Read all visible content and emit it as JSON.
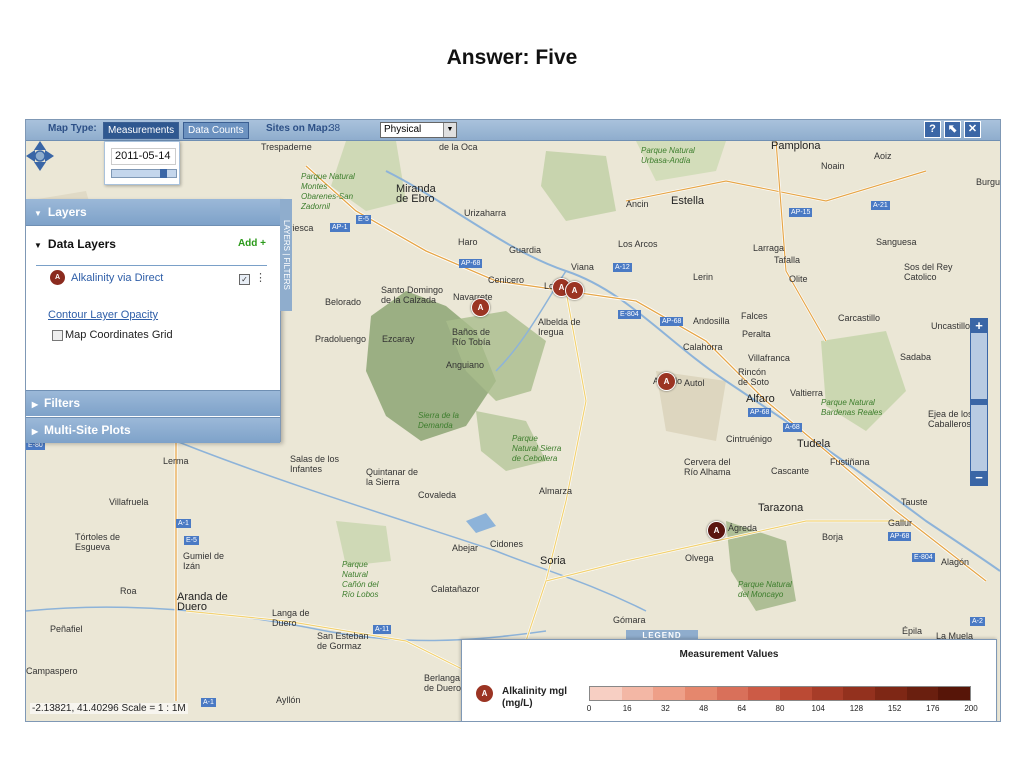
{
  "slide": {
    "title": "Answer: Five"
  },
  "toolbar": {
    "map_type_label": "Map Type:",
    "measurements_btn": "Measurements",
    "data_counts_btn": "Data Counts",
    "sites_on_map_label": "Sites on Map:",
    "sites_on_map_count": "38",
    "basemap_value": "Physical",
    "help_icon": "?",
    "print_icon": "⬉",
    "close_icon": "✕"
  },
  "date_popup": {
    "value": "2011-05-14",
    "slider_fraction": 0.85
  },
  "layers_panel": {
    "header": "Layers",
    "data_layers_title": "Data Layers",
    "add_link": "Add +",
    "layer_name": "Alkalinity via Direct",
    "layer_icon_text": "A",
    "layer_checked": true,
    "contour_link": "Contour Layer Opacity",
    "grid_label": "Map Coordinates Grid",
    "filters_header": "Filters",
    "multisite_header": "Multi-Site Plots",
    "side_tab": "LAYERS | FILTERS"
  },
  "places": [
    "Trespaderne",
    "de la Oca",
    "Pamplona",
    "Aoiz",
    "Noain",
    "Burgu",
    "Miranda de Ebro",
    "Parque Natural Montes Obarenes-San Zadornil",
    "Urizaharra",
    "Ancin",
    "Estella",
    "Haro",
    "Guardia",
    "Los Arcos",
    "Larraga",
    "Sanguesa",
    "Tafalla",
    "Viana",
    "Cenicero",
    "Lerin",
    "Olite",
    "Sos del Rey Catolico",
    "Santo Domingo de la Calzada",
    "Belorado",
    "Navarrete",
    "Logroño",
    "Albelda de Iregua",
    "Andosilla",
    "Falces",
    "Carcastillo",
    "Uncastillo",
    "Ezcaray",
    "Pradoluengo",
    "Baños de Río Tobía",
    "Calahorra",
    "Peralta",
    "Villafranca",
    "Sadaba",
    "Anguiano",
    "Arnedo",
    "Autol",
    "Rincón de Soto",
    "Valtierra",
    "Alfaro",
    "Parque Natural Bardenas Reales",
    "Ejea de los Caballeros",
    "Lerma",
    "Sierra de la Demanda",
    "Parque Natural Sierra de Cebollera",
    "Cintruénigo",
    "Tudela",
    "Salas de los Infantes",
    "Quintanar de la Sierra",
    "Cervera del Río Alhama",
    "Cascante",
    "Fustiñana",
    "Villafruela",
    "Covaleda",
    "Almarza",
    "Tarazona",
    "Tauste",
    "Tórtoles de Esgueva",
    "Gumiel de Izán",
    "Abejar",
    "Cidones",
    "Soria",
    "Ágreda",
    "Borja",
    "Gallur",
    "Parque Natural Cañón del Río Lobos",
    "Calatañazor",
    "Olvega",
    "Parque Natural del Moncayo",
    "Alagón",
    "Roa",
    "Aranda de Duero",
    "Langa de Duero",
    "Peñafiel",
    "San Esteban de Gormaz",
    "Gómara",
    "Épila",
    "La Muela",
    "Campaspero",
    "Berlanga de Duero",
    "Ayllón",
    "Viviesca",
    "Parque Natural Urbasa-Andía"
  ],
  "roads": [
    "AP-1",
    "E-5",
    "AP-68",
    "A-12",
    "AP-15",
    "A-21",
    "E-804",
    "AP-68",
    "A-68",
    "AP-68",
    "A-1",
    "E-5",
    "A-11",
    "AP-68",
    "E-804",
    "A-2",
    "A-1",
    "E-80"
  ],
  "markers": [
    {
      "label": "A",
      "near": "Navarrete"
    },
    {
      "label": "A",
      "near": "Logroño 1"
    },
    {
      "label": "A",
      "near": "Logroño 2"
    },
    {
      "label": "A",
      "near": "Arnedo"
    },
    {
      "label": "A",
      "near": "Ágreda"
    }
  ],
  "legend": {
    "tab": "LEGEND",
    "title": "Measurement Values",
    "series_name": "Alkalinity mgl (mg/L)",
    "icon_text": "A",
    "colors": [
      "#f7cfc3",
      "#f3b7a5",
      "#ee9f88",
      "#e5876d",
      "#d9705a",
      "#cc5b46",
      "#bb4a34",
      "#a73c28",
      "#93311e",
      "#7e2715",
      "#6a1f0f",
      "#571508"
    ],
    "ticks": [
      "0",
      "16",
      "32",
      "48",
      "64",
      "80",
      "104",
      "128",
      "152",
      "176",
      "200"
    ]
  },
  "status": {
    "coords_text": "-2.13821, 41.40296 Scale = 1 : 1M"
  }
}
